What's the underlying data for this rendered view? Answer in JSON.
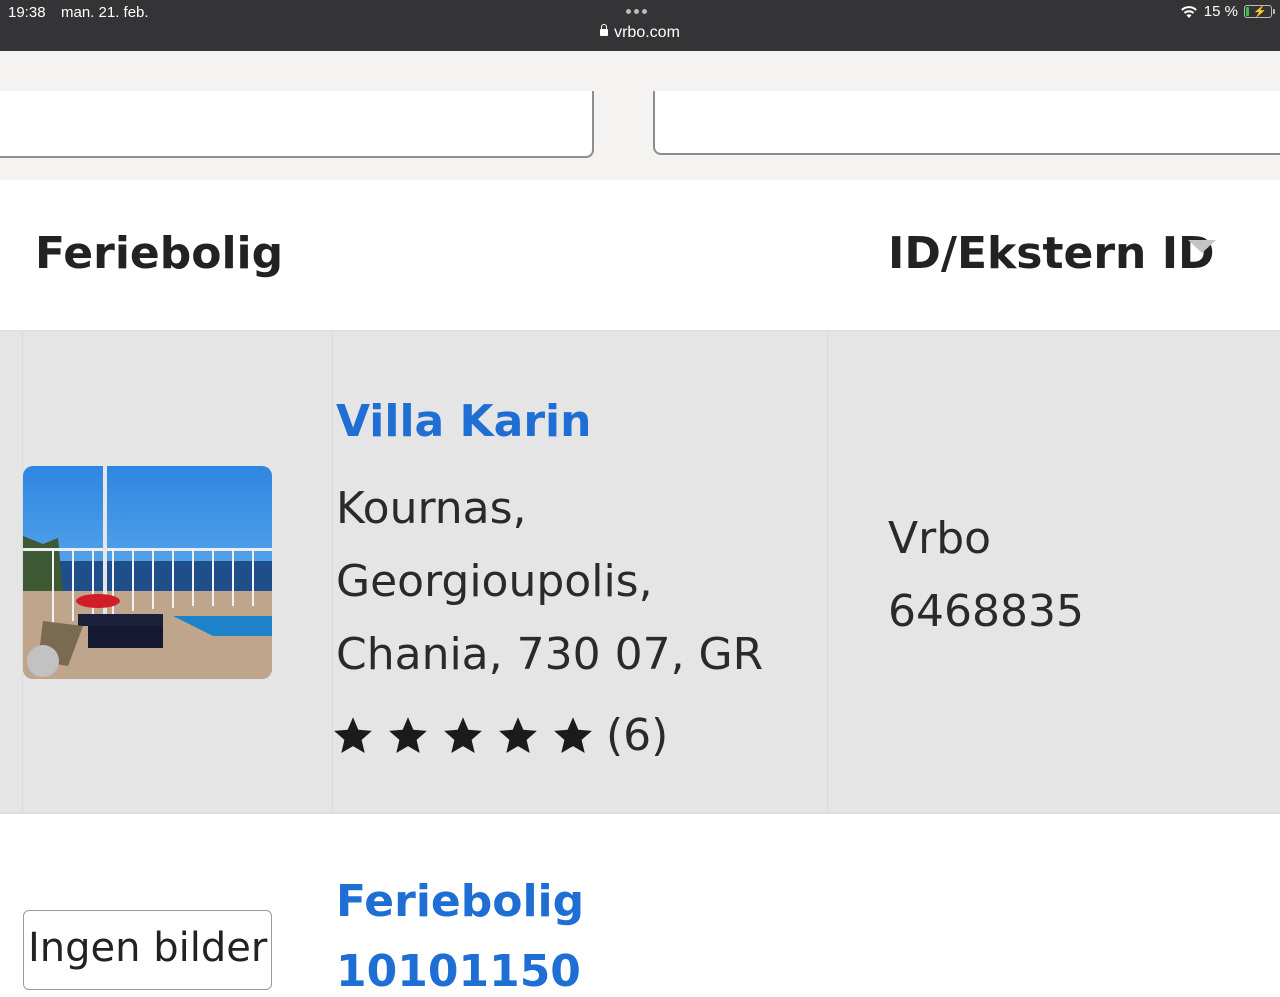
{
  "status_bar": {
    "time": "19:38",
    "date": "man. 21. feb.",
    "url": "vrbo.com",
    "battery": "15 %",
    "battery_level": 0.15
  },
  "table": {
    "header_property": "Feriebolig",
    "header_id": "ID/Ekstern ID"
  },
  "rows": [
    {
      "title": "Villa Karin",
      "address_line1": "Kournas,",
      "address_line2": "Georgioupolis,",
      "address_line3": "Chania, 730 07, GR",
      "rating_stars": 5,
      "review_count": "(6)",
      "source": "Vrbo",
      "external_id": "6468835"
    },
    {
      "title": "Feriebolig",
      "subtitle_partial": "10101150",
      "no_image_text": "Ingen bilder"
    }
  ],
  "colors": {
    "link": "#1f6ed4",
    "row_highlight": "#e5e5e6",
    "status_bar": "#343436"
  }
}
